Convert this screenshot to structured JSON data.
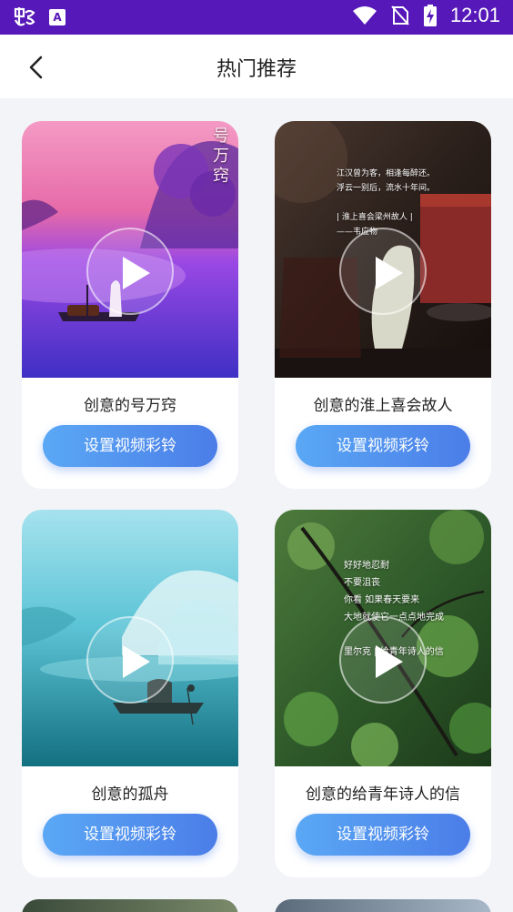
{
  "status_bar": {
    "time": "12:01",
    "app_icon": "bug-app-icon",
    "a_badge": "A",
    "icons": [
      "wifi-icon",
      "no-sim-icon",
      "battery-charging-icon"
    ]
  },
  "header": {
    "title": "热门推荐",
    "back_icon": "chevron-left-icon"
  },
  "cards": [
    {
      "title": "创意的号万窍",
      "button_label": "设置视频彩铃",
      "overlay_text": "号万窍",
      "colors": [
        "#f07ab8",
        "#8a3de0",
        "#3b2bb8"
      ]
    },
    {
      "title": "创意的淮上喜会故人",
      "button_label": "设置视频彩铃",
      "overlay_text": "江汉曾为客，相逢每醉还。\n浮云一别后，流水十年间。\n\n| 淮上喜会梁州故人 |\n——韦应物",
      "colors": [
        "#3a2a22",
        "#6b2a24",
        "#1e1612"
      ]
    },
    {
      "title": "创意的孤舟",
      "button_label": "设置视频彩铃",
      "overlay_text": "",
      "colors": [
        "#7fd0e0",
        "#2aa5b8",
        "#136c7a"
      ]
    },
    {
      "title": "创意的给青年诗人的信",
      "button_label": "设置视频彩铃",
      "overlay_text": "好好地忍耐\n不要沮丧\n你看 如果春天要来\n大地就使它一点点地完成\n\n里尔克 | 给青年诗人的信",
      "colors": [
        "#2f5a2a",
        "#4e8a3c",
        "#1a3418"
      ]
    }
  ]
}
